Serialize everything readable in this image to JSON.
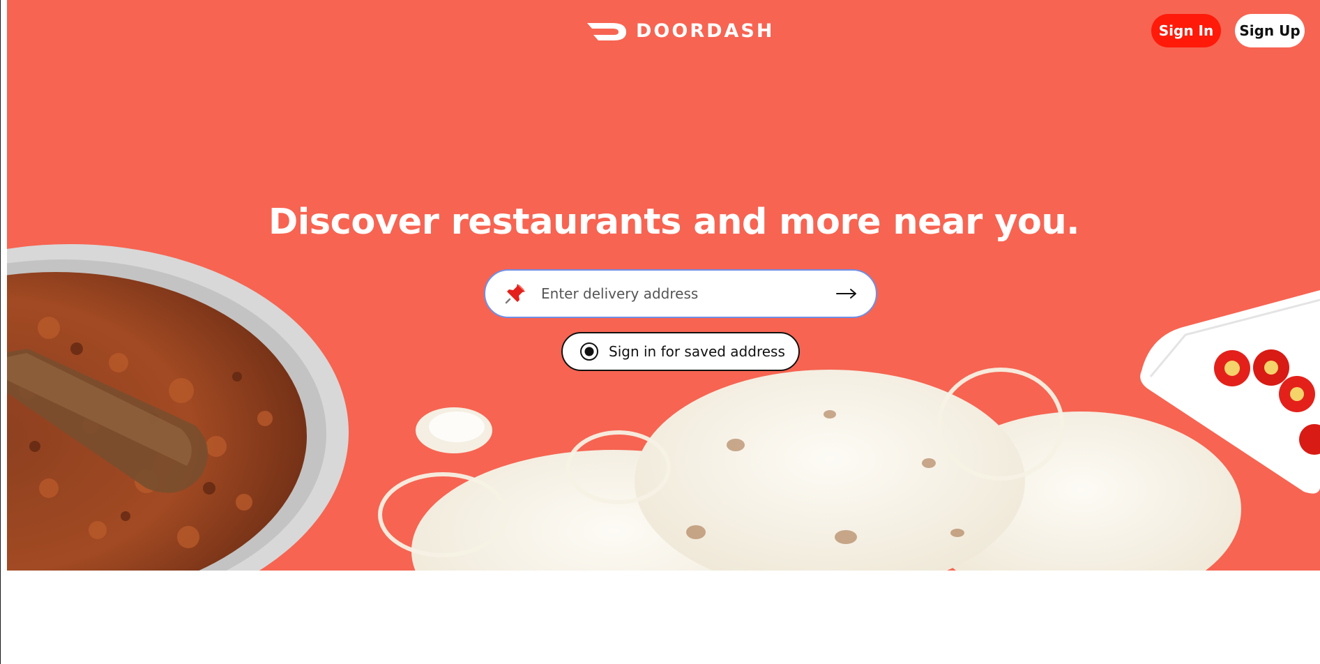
{
  "header": {
    "brand_name": "DOORDASH",
    "sign_in_label": "Sign In",
    "sign_up_label": "Sign Up"
  },
  "hero": {
    "headline": "Discover restaurants and more near you.",
    "address": {
      "placeholder": "Enter delivery address",
      "value": ""
    },
    "saved_address_label": "Sign in for saved address"
  },
  "colors": {
    "hero_background": "#f76452",
    "sign_in_button": "#ff1a0a",
    "address_focus_border": "#6f8fe6"
  },
  "icons": {
    "brand": "doordash-logo-icon",
    "address": "pushpin-icon",
    "submit": "arrow-right-icon",
    "saved": "radio-icon"
  }
}
